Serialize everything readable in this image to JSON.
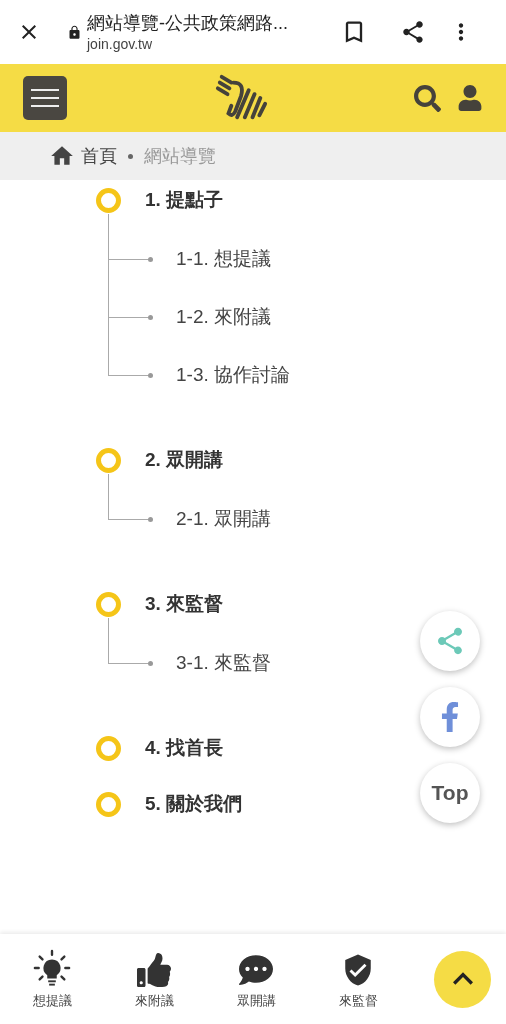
{
  "browser": {
    "title": "網站導覽-公共政策網路...",
    "url": "join.gov.tw"
  },
  "breadcrumb": [
    "首頁",
    "網站導覽"
  ],
  "sections": [
    {
      "title": "1. 提點子",
      "children": [
        {
          "title": "1-1. 想提議"
        },
        {
          "title": "1-2. 來附議"
        },
        {
          "title": "1-3. 協作討論"
        }
      ]
    },
    {
      "title": "2. 眾開講",
      "children": [
        {
          "title": "2-1. 眾開講"
        }
      ]
    },
    {
      "title": "3. 來監督",
      "children": [
        {
          "title": "3-1. 來監督"
        }
      ]
    },
    {
      "title": "4. 找首長"
    },
    {
      "title": "5. 關於我們"
    }
  ],
  "floating": {
    "top_label": "Top"
  },
  "bottom_nav": [
    {
      "kind": "bulb",
      "label": "想提議"
    },
    {
      "kind": "thumb",
      "label": "來附議"
    },
    {
      "kind": "chat",
      "label": "眾開講"
    },
    {
      "kind": "shield",
      "label": "來監督"
    }
  ]
}
